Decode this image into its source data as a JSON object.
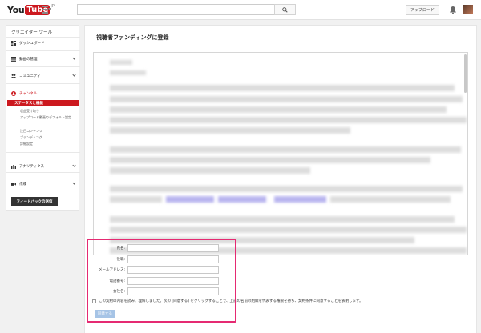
{
  "header": {
    "logo_you": "You",
    "logo_tube": "Tube",
    "logo_region": "JP",
    "search_placeholder": "",
    "upload_label": "アップロード"
  },
  "sidebar": {
    "title": "クリエイター ツール",
    "items": [
      {
        "label": "ダッシュボード",
        "icon": "dashboard-icon"
      },
      {
        "label": "動画の管理",
        "icon": "video-manager-icon"
      },
      {
        "label": "コミュニティ",
        "icon": "community-icon"
      },
      {
        "label": "チャンネル",
        "icon": "channel-icon"
      },
      {
        "label": "アナリティクス",
        "icon": "analytics-icon"
      },
      {
        "label": "作成",
        "icon": "create-icon"
      }
    ],
    "active_sub": "ステータスと機能",
    "subitems": [
      "収益受け取り",
      "アップロード動画のデフォルト設定",
      "注目コンテンツ",
      "ブランディング",
      "詳細設定"
    ],
    "feedback_label": "フィードバックの送信"
  },
  "main": {
    "title": "視聴者ファンディングに登録",
    "form": {
      "fields": [
        {
          "label": "氏名:",
          "value": ""
        },
        {
          "label": "役職:",
          "value": ""
        },
        {
          "label": "メールアドレス:",
          "value": ""
        },
        {
          "label": "電話番号:",
          "value": ""
        },
        {
          "label": "会社名:",
          "value": ""
        }
      ],
      "agree_text": "この契約の内容を読み、理解しました。次の [同意する] をクリックすることで、上記の名前の組織を代表する権限を持ち、契約条件に同意することを表明します。",
      "agree_button": "同意する"
    }
  },
  "colors": {
    "brand_red": "#cc181e",
    "highlight": "#e52a72",
    "agree_button": "#a6c4e6"
  }
}
